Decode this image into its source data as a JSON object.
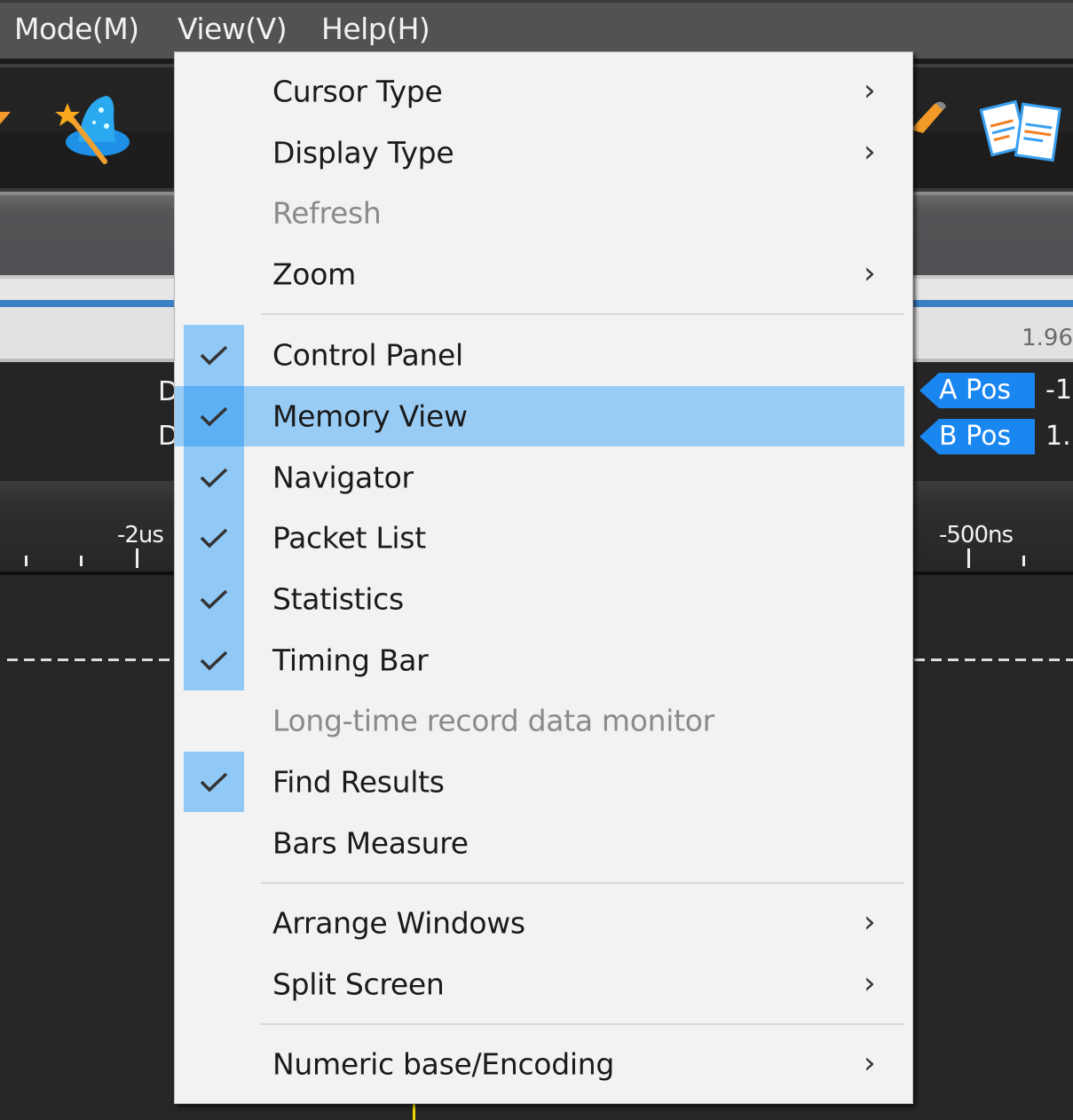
{
  "menubar": {
    "items": [
      {
        "label": "Mode(M)"
      },
      {
        "label": "View(V)"
      },
      {
        "label": "Help(H)"
      }
    ]
  },
  "toolbar": {
    "icons": [
      "wizard-hat-icon",
      "pencil-icon",
      "documents-icon"
    ]
  },
  "ruler": {
    "value": "1.96"
  },
  "cursors": {
    "rows": [
      {
        "label": "D",
        "tag": "A Pos",
        "value": "-1"
      },
      {
        "label": "D",
        "tag": "B Pos",
        "value": "1."
      }
    ]
  },
  "time_axis": {
    "labels": [
      "-2us",
      "-500ns"
    ]
  },
  "view_menu": {
    "items": [
      {
        "label": "Cursor Type",
        "submenu": true,
        "checked": false,
        "disabled": false
      },
      {
        "label": "Display Type",
        "submenu": true,
        "checked": false,
        "disabled": false
      },
      {
        "label": "Refresh",
        "submenu": false,
        "checked": false,
        "disabled": true
      },
      {
        "label": "Zoom",
        "submenu": true,
        "checked": false,
        "disabled": false
      },
      {
        "label": "Control Panel",
        "submenu": false,
        "checked": true,
        "disabled": false
      },
      {
        "label": "Memory View",
        "submenu": false,
        "checked": true,
        "disabled": false,
        "highlighted": true
      },
      {
        "label": "Navigator",
        "submenu": false,
        "checked": true,
        "disabled": false
      },
      {
        "label": "Packet List",
        "submenu": false,
        "checked": true,
        "disabled": false
      },
      {
        "label": "Statistics",
        "submenu": false,
        "checked": true,
        "disabled": false
      },
      {
        "label": "Timing Bar",
        "submenu": false,
        "checked": true,
        "disabled": false
      },
      {
        "label": "Long-time record data monitor",
        "submenu": false,
        "checked": false,
        "disabled": true
      },
      {
        "label": "Find Results",
        "submenu": false,
        "checked": true,
        "disabled": false
      },
      {
        "label": "Bars Measure",
        "submenu": false,
        "checked": false,
        "disabled": false
      },
      {
        "label": "Arrange Windows",
        "submenu": true,
        "checked": false,
        "disabled": false
      },
      {
        "label": "Split Screen",
        "submenu": true,
        "checked": false,
        "disabled": false
      },
      {
        "label": "Numeric base/Encoding",
        "submenu": true,
        "checked": false,
        "disabled": false
      }
    ],
    "submenu_glyph": "›",
    "colors": {
      "check_bg": "#90c8f6",
      "highlight_bg": "#99ccf5",
      "tag_blue": "#1a86f0"
    }
  }
}
